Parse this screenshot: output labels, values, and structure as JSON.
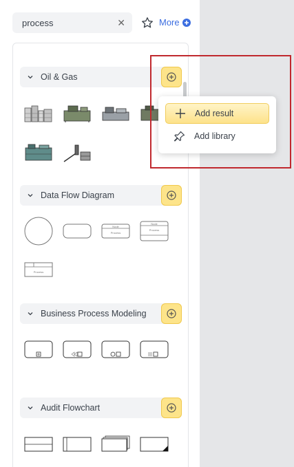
{
  "search": {
    "value": "process"
  },
  "toolbar": {
    "more_label": "More"
  },
  "sections": [
    {
      "title": "Oil & Gas"
    },
    {
      "title": "Data Flow Diagram"
    },
    {
      "title": "Business Process Modeling"
    },
    {
      "title": "Audit Flowchart"
    }
  ],
  "shape_labels": {
    "node": "Node",
    "process": "Process"
  },
  "context_menu": {
    "add_result": "Add result",
    "add_library": "Add library"
  },
  "colors": {
    "accent": "#3c6ee0",
    "add_button": "#fde48a",
    "highlight": "#c0282d"
  }
}
